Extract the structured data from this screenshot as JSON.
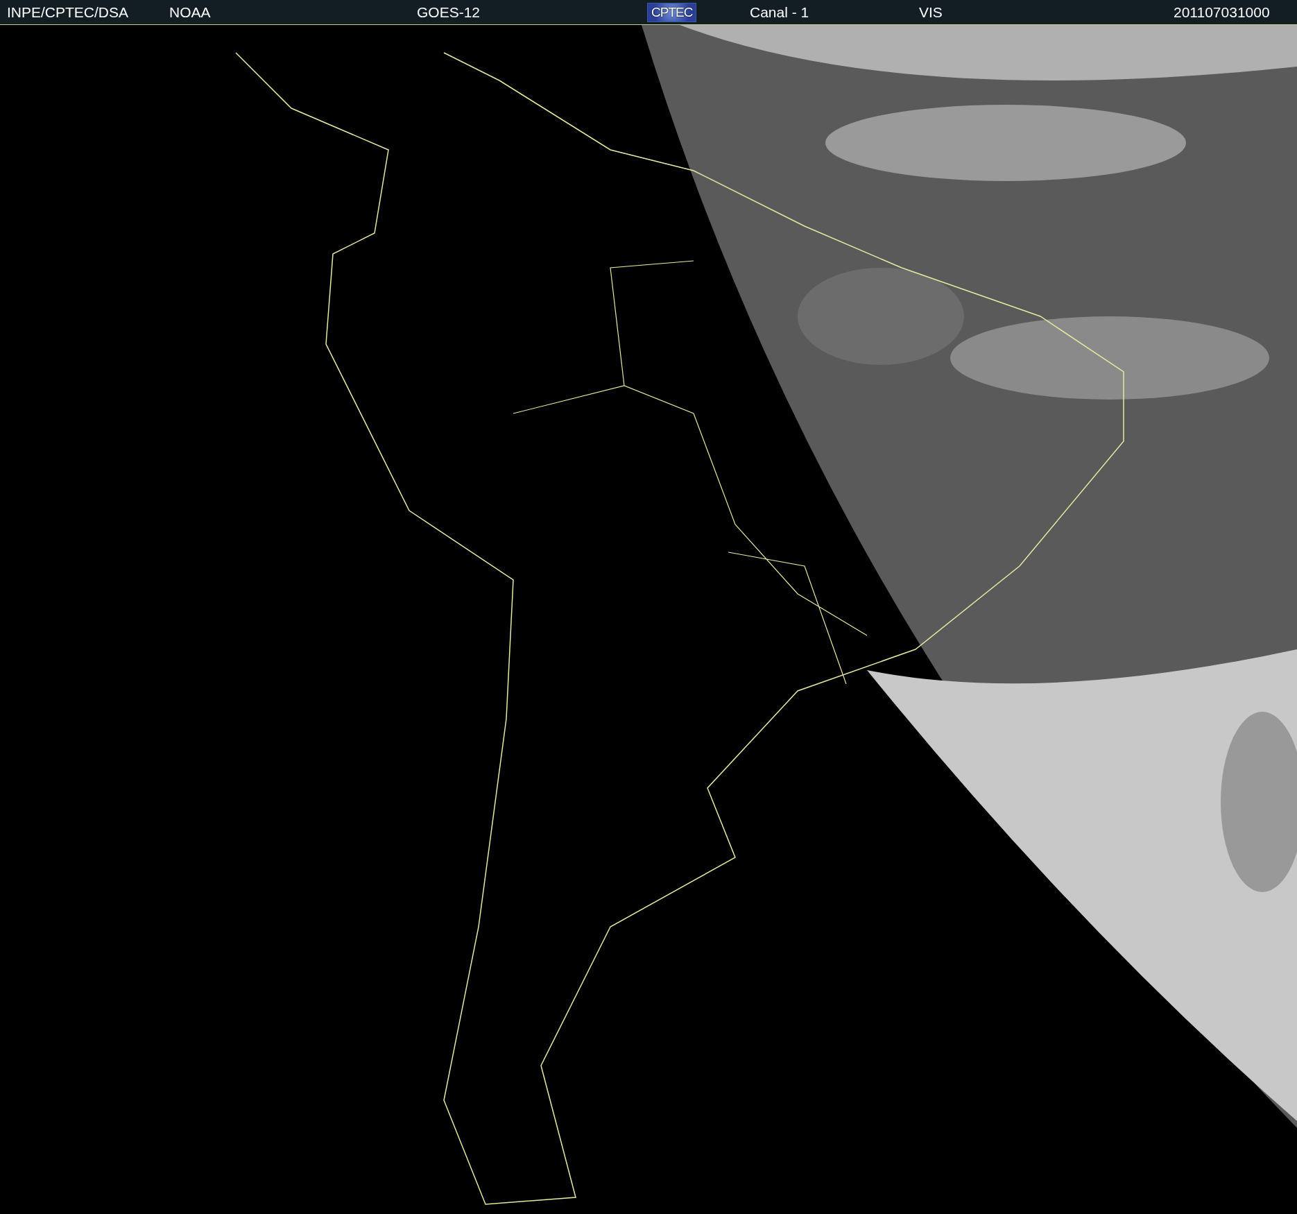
{
  "header": {
    "items": [
      {
        "kind": "text",
        "text": "INPE/CPTEC/DSA"
      },
      {
        "kind": "text",
        "text": "NOAA"
      },
      {
        "kind": "text",
        "text": "GOES-12"
      },
      {
        "kind": "logo",
        "text": "CPTEC"
      },
      {
        "kind": "text",
        "text": "Canal - 1"
      },
      {
        "kind": "text",
        "text": "VIS"
      },
      {
        "kind": "text",
        "text": "201107031000"
      }
    ]
  }
}
